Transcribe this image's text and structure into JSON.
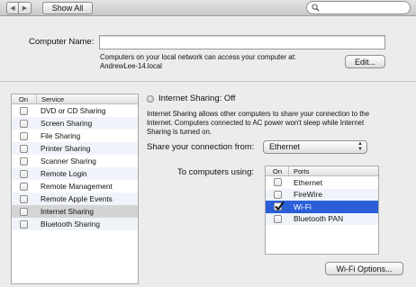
{
  "toolbar": {
    "back_glyph": "◀",
    "forward_glyph": "▶",
    "show_all_label": "Show All",
    "search_value": "",
    "search_icon": "magnifier-icon"
  },
  "computer_name": {
    "label": "Computer Name:",
    "value": "",
    "description_line1": "Computers on your local network can access your computer at:",
    "description_line2": "AndrewLee-14.local",
    "edit_label": "Edit..."
  },
  "services": {
    "header_on": "On",
    "header_service": "Service",
    "items": [
      {
        "label": "DVD or CD Sharing",
        "checked": false
      },
      {
        "label": "Screen Sharing",
        "checked": false
      },
      {
        "label": "File Sharing",
        "checked": false
      },
      {
        "label": "Printer Sharing",
        "checked": false
      },
      {
        "label": "Scanner Sharing",
        "checked": false
      },
      {
        "label": "Remote Login",
        "checked": false
      },
      {
        "label": "Remote Management",
        "checked": false
      },
      {
        "label": "Remote Apple Events",
        "checked": false
      },
      {
        "label": "Internet Sharing",
        "checked": false,
        "selected": true
      },
      {
        "label": "Bluetooth Sharing",
        "checked": false
      }
    ]
  },
  "detail": {
    "status_text": "Internet Sharing: Off",
    "description_line1": "Internet Sharing allows other computers to share your connection to the",
    "description_line2": "Internet. Computers connected to AC power won't sleep while Internet",
    "description_line3": "Sharing is turned on.",
    "share_from_label": "Share your connection from:",
    "share_from_value": "Ethernet",
    "to_computers_label": "To computers using:",
    "ports_header_on": "On",
    "ports_header_ports": "Ports",
    "ports": [
      {
        "label": "Ethernet",
        "checked": false
      },
      {
        "label": "FireWire",
        "checked": false
      },
      {
        "label": "Wi-Fi",
        "checked": true,
        "selected": true
      },
      {
        "label": "Bluetooth PAN",
        "checked": false
      }
    ],
    "wifi_options_label": "Wi-Fi Options..."
  },
  "colors": {
    "selection_blue": "#2a5fd8",
    "selection_gray": "#d4d4d4",
    "window_bg": "#ececec"
  }
}
